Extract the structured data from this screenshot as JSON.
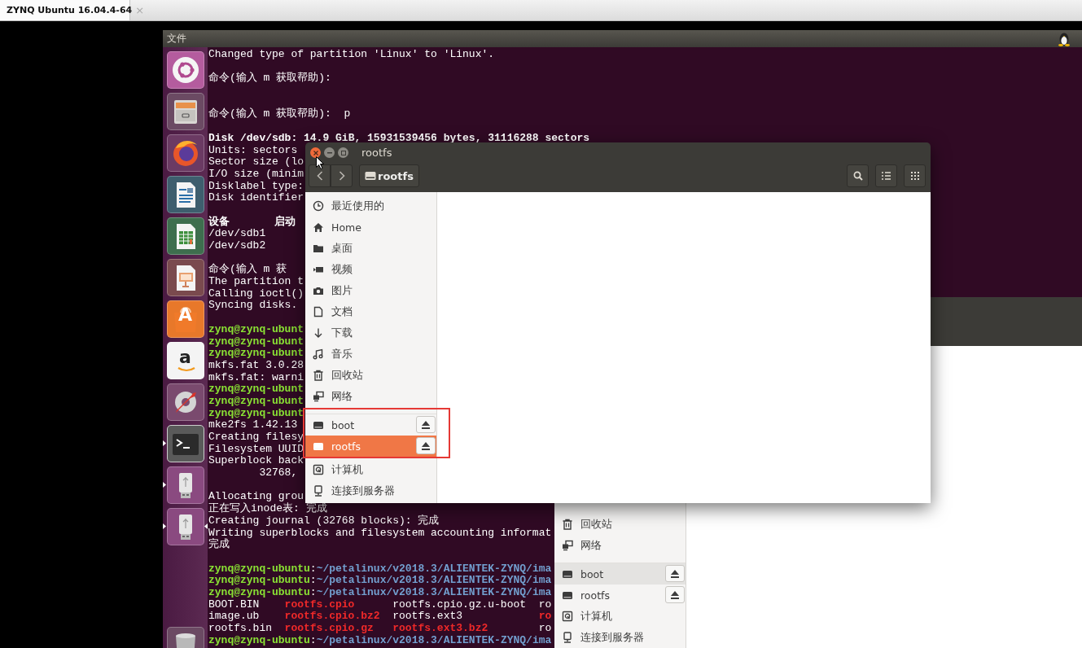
{
  "vm_tab": {
    "title": "ZYNQ Ubuntu 16.04.4-64",
    "close": "×"
  },
  "panel": {
    "menu": "文件"
  },
  "launcher": [
    {
      "kind": "dash",
      "running": false,
      "focused": false
    },
    {
      "kind": "files",
      "running": false,
      "focused": false
    },
    {
      "kind": "browser",
      "running": false,
      "focused": false
    },
    {
      "kind": "writer",
      "running": false,
      "focused": false
    },
    {
      "kind": "calc",
      "running": false,
      "focused": false
    },
    {
      "kind": "impress",
      "running": false,
      "focused": false
    },
    {
      "kind": "store",
      "glyph": "A",
      "running": false,
      "focused": false
    },
    {
      "kind": "letter",
      "glyph": "a",
      "running": false,
      "focused": false
    },
    {
      "kind": "settings",
      "running": false,
      "focused": false
    },
    {
      "kind": "terminal",
      "running": true,
      "focused": false
    },
    {
      "kind": "usb",
      "running": true,
      "focused": false
    },
    {
      "kind": "usb",
      "running": true,
      "focused": true
    },
    {
      "kind": "trash",
      "running": false,
      "focused": false
    }
  ],
  "terminal": {
    "lines": [
      {
        "kind": "text",
        "text": "Changed type of partition 'Linux' to 'Linux'."
      },
      {
        "kind": "blank"
      },
      {
        "kind": "text",
        "text": "命令(输入 m 获取帮助):"
      },
      {
        "kind": "blank"
      },
      {
        "kind": "blank"
      },
      {
        "kind": "text",
        "text": "命令(输入 m 获取帮助):  p"
      },
      {
        "kind": "blank"
      },
      {
        "kind": "text",
        "text": "Disk /dev/sdb: 14.9 GiB, 15931539456 bytes, 31116288 sectors",
        "bold": true
      },
      {
        "kind": "text",
        "text": "Units: sectors"
      },
      {
        "kind": "text",
        "text": "Sector size (lo"
      },
      {
        "kind": "text",
        "text": "I/O size (minim"
      },
      {
        "kind": "text",
        "text": "Disklabel type:"
      },
      {
        "kind": "text",
        "text": "Disk identifier"
      },
      {
        "kind": "blank"
      },
      {
        "kind": "text",
        "text": "设备       启动",
        "bold": true
      },
      {
        "kind": "text",
        "text": "/dev/sdb1"
      },
      {
        "kind": "text",
        "text": "/dev/sdb2"
      },
      {
        "kind": "blank"
      },
      {
        "kind": "text",
        "text": "命令(输入 m 获"
      },
      {
        "kind": "text",
        "text": "The partition t"
      },
      {
        "kind": "text",
        "text": "Calling ioctl()"
      },
      {
        "kind": "text",
        "text": "Syncing disks."
      },
      {
        "kind": "blank"
      },
      {
        "kind": "prompt",
        "user": "zynq@zynq-ubunt"
      },
      {
        "kind": "prompt",
        "user": "zynq@zynq-ubunt"
      },
      {
        "kind": "prompt",
        "user": "zynq@zynq-ubunt"
      },
      {
        "kind": "text",
        "text": "mkfs.fat 3.0.28"
      },
      {
        "kind": "text",
        "text": "mkfs.fat: warni"
      },
      {
        "kind": "prompt",
        "user": "zynq@zynq-ubunt"
      },
      {
        "kind": "prompt",
        "user": "zynq@zynq-ubunt"
      },
      {
        "kind": "prompt",
        "user": "zynq@zynq-ubunt"
      },
      {
        "kind": "text",
        "text": "mke2fs 1.42.13"
      },
      {
        "kind": "text",
        "text": "Creating filesy"
      },
      {
        "kind": "text",
        "text": "Filesystem UUID"
      },
      {
        "kind": "text",
        "text": "Superblock back"
      },
      {
        "kind": "text",
        "text": "        32768,"
      },
      {
        "kind": "blank"
      },
      {
        "kind": "text",
        "text": "Allocating grou"
      },
      {
        "kind": "text",
        "text": "正在写入inode表: 完成"
      },
      {
        "kind": "text",
        "text": "Creating journal (32768 blocks): 完成"
      },
      {
        "kind": "text",
        "text": "Writing superblocks and filesystem accounting informat"
      },
      {
        "kind": "text",
        "text": "完成"
      },
      {
        "kind": "blank"
      },
      {
        "kind": "prompt",
        "user": "zynq@zynq-ubuntu",
        "sep": ":",
        "path": "~/petalinux/v2018.3/ALIENTEK-ZYNQ/ima"
      },
      {
        "kind": "prompt",
        "user": "zynq@zynq-ubuntu",
        "sep": ":",
        "path": "~/petalinux/v2018.3/ALIENTEK-ZYNQ/ima"
      },
      {
        "kind": "prompt",
        "user": "zynq@zynq-ubuntu",
        "sep": ":",
        "path": "~/petalinux/v2018.3/ALIENTEK-ZYNQ/ima"
      },
      {
        "kind": "ls",
        "files": [
          {
            "name": "BOOT.BIN",
            "archive": false
          },
          {
            "name": "rootfs.cpio",
            "archive": true
          },
          {
            "name": "rootfs.cpio.gz.u-boot",
            "archive": false
          },
          {
            "name": "ro",
            "archive": false
          }
        ]
      },
      {
        "kind": "ls",
        "files": [
          {
            "name": "image.ub",
            "archive": false
          },
          {
            "name": "rootfs.cpio.bz2",
            "archive": true
          },
          {
            "name": "rootfs.ext3",
            "archive": false
          },
          {
            "name": "ro",
            "archive": true
          }
        ]
      },
      {
        "kind": "ls",
        "files": [
          {
            "name": "rootfs.bin",
            "archive": false
          },
          {
            "name": "rootfs.cpio.gz",
            "archive": true
          },
          {
            "name": "rootfs.ext3.bz2",
            "archive": true
          },
          {
            "name": "ro",
            "archive": false
          }
        ]
      },
      {
        "kind": "prompt",
        "user": "zynq@zynq-ubuntu",
        "sep": ":",
        "path": "~/petalinux/v2018.3/ALIENTEK-ZYNQ/ima"
      }
    ]
  },
  "file_window": {
    "title": "rootfs",
    "path": "rootfs",
    "sidebar": {
      "places": [
        {
          "label": "最近使用的",
          "kind": "recent",
          "selected": false
        },
        {
          "label": "Home",
          "kind": "home",
          "selected": false
        },
        {
          "label": "桌面",
          "kind": "desktop",
          "selected": false
        },
        {
          "label": "视频",
          "kind": "video",
          "selected": false
        },
        {
          "label": "图片",
          "kind": "pictures",
          "selected": false
        },
        {
          "label": "文档",
          "kind": "documents",
          "selected": false
        },
        {
          "label": "下载",
          "kind": "downloads",
          "selected": false
        },
        {
          "label": "音乐",
          "kind": "music",
          "selected": false
        },
        {
          "label": "回收站",
          "kind": "trash",
          "selected": false
        },
        {
          "label": "网络",
          "kind": "network",
          "selected": false
        }
      ],
      "devices": [
        {
          "label": "boot",
          "kind": "drive",
          "selected": false,
          "hovered": false
        },
        {
          "label": "rootfs",
          "kind": "drive",
          "selected": true,
          "hovered": false
        }
      ],
      "more": [
        {
          "label": "计算机",
          "kind": "computer",
          "selected": false
        },
        {
          "label": "连接到服务器",
          "kind": "server",
          "selected": false
        }
      ]
    }
  },
  "back_window": {
    "sidebar": {
      "places": [
        {
          "label": "回收站",
          "kind": "trash",
          "selected": false
        },
        {
          "label": "网络",
          "kind": "network",
          "selected": false
        }
      ],
      "devices": [
        {
          "label": "boot",
          "kind": "drive",
          "selected": false,
          "hovered": true
        },
        {
          "label": "rootfs",
          "kind": "drive",
          "selected": false,
          "hovered": false
        }
      ],
      "more": [
        {
          "label": "计算机",
          "kind": "computer",
          "selected": false
        },
        {
          "label": "连接到服务器",
          "kind": "server",
          "selected": false
        }
      ]
    }
  }
}
